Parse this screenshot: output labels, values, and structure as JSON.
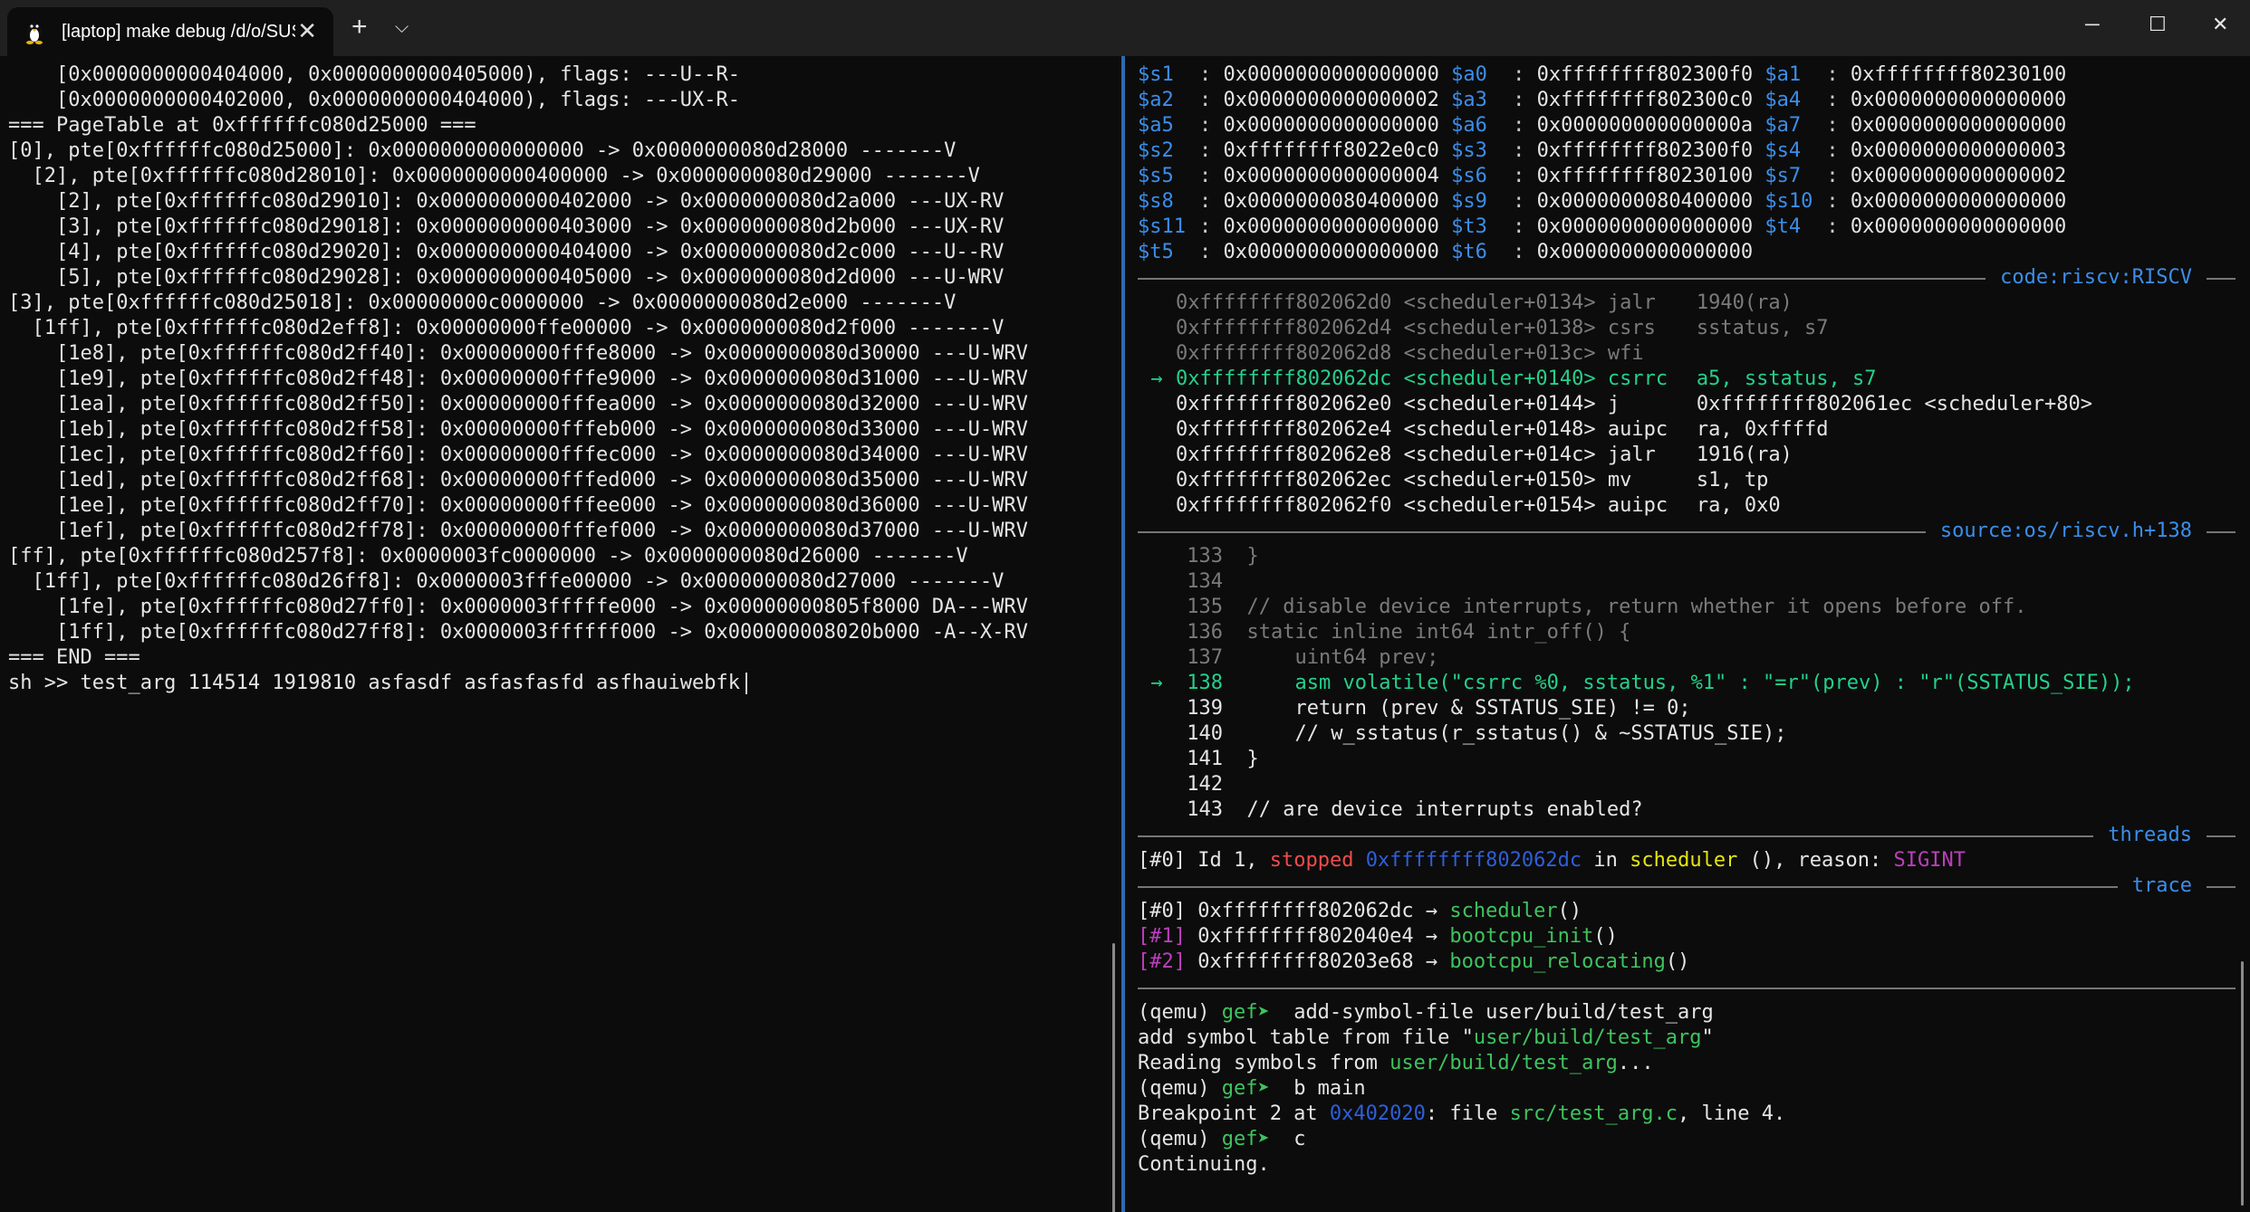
{
  "window": {
    "tab_title": "[laptop] make debug /d/o/SUS",
    "icons": [
      "linux-penguin-icon",
      "close-icon",
      "plus-icon",
      "chevron-down-icon",
      "minimize-icon",
      "maximize-icon",
      "window-close-icon"
    ]
  },
  "colors": {
    "background": "#0c0c0c",
    "register": "#3b8eea",
    "separator_title": "#3b8eea",
    "current_line": "#23d18b",
    "divider": "#2d6ab0"
  },
  "left": {
    "lines": [
      "    [0x0000000000404000, 0x0000000000405000), flags: ---U--R-",
      "    [0x0000000000402000, 0x0000000000404000), flags: ---UX-R-",
      "=== PageTable at 0xffffffc080d25000 ===",
      "[0], pte[0xffffffc080d25000]: 0x0000000000000000 -> 0x0000000080d28000 -------V",
      "  [2], pte[0xffffffc080d28010]: 0x0000000000400000 -> 0x0000000080d29000 -------V",
      "    [2], pte[0xffffffc080d29010]: 0x0000000000402000 -> 0x0000000080d2a000 ---UX-RV",
      "    [3], pte[0xffffffc080d29018]: 0x0000000000403000 -> 0x0000000080d2b000 ---UX-RV",
      "    [4], pte[0xffffffc080d29020]: 0x0000000000404000 -> 0x0000000080d2c000 ---U--RV",
      "    [5], pte[0xffffffc080d29028]: 0x0000000000405000 -> 0x0000000080d2d000 ---U-WRV",
      "[3], pte[0xffffffc080d25018]: 0x00000000c0000000 -> 0x0000000080d2e000 -------V",
      "  [1ff], pte[0xffffffc080d2eff8]: 0x00000000ffe00000 -> 0x0000000080d2f000 -------V",
      "    [1e8], pte[0xffffffc080d2ff40]: 0x00000000fffe8000 -> 0x0000000080d30000 ---U-WRV",
      "    [1e9], pte[0xffffffc080d2ff48]: 0x00000000fffe9000 -> 0x0000000080d31000 ---U-WRV",
      "    [1ea], pte[0xffffffc080d2ff50]: 0x00000000fffea000 -> 0x0000000080d32000 ---U-WRV",
      "    [1eb], pte[0xffffffc080d2ff58]: 0x00000000fffeb000 -> 0x0000000080d33000 ---U-WRV",
      "    [1ec], pte[0xffffffc080d2ff60]: 0x00000000fffec000 -> 0x0000000080d34000 ---U-WRV",
      "    [1ed], pte[0xffffffc080d2ff68]: 0x00000000fffed000 -> 0x0000000080d35000 ---U-WRV",
      "    [1ee], pte[0xffffffc080d2ff70]: 0x00000000fffee000 -> 0x0000000080d36000 ---U-WRV",
      "    [1ef], pte[0xffffffc080d2ff78]: 0x00000000fffef000 -> 0x0000000080d37000 ---U-WRV",
      "[ff], pte[0xffffffc080d257f8]: 0x0000003fc0000000 -> 0x0000000080d26000 -------V",
      "  [1ff], pte[0xffffffc080d26ff8]: 0x0000003fffe00000 -> 0x0000000080d27000 -------V",
      "    [1fe], pte[0xffffffc080d27ff0]: 0x0000003fffffe000 -> 0x00000000805f8000 DA---WRV",
      "    [1ff], pte[0xffffffc080d27ff8]: 0x0000003ffffff000 -> 0x000000008020b000 -A--X-RV",
      "=== END ==="
    ],
    "prompt": "sh >> test_arg 114514 1919810 asfasdf asfasfasfd asfhauiwebfk"
  },
  "registers": [
    [
      [
        "$s1",
        "0x0000000000000000"
      ],
      [
        "$a0",
        "0xffffffff802300f0"
      ],
      [
        "$a1",
        "0xffffffff80230100"
      ]
    ],
    [
      [
        "$a2",
        "0x0000000000000002"
      ],
      [
        "$a3",
        "0xffffffff802300c0"
      ],
      [
        "$a4",
        "0x0000000000000000"
      ]
    ],
    [
      [
        "$a5",
        "0x0000000000000000"
      ],
      [
        "$a6",
        "0x000000000000000a"
      ],
      [
        "$a7",
        "0x0000000000000000"
      ]
    ],
    [
      [
        "$s2",
        "0xffffffff8022e0c0"
      ],
      [
        "$s3",
        "0xffffffff802300f0"
      ],
      [
        "$s4",
        "0x0000000000000003"
      ]
    ],
    [
      [
        "$s5",
        "0x0000000000000004"
      ],
      [
        "$s6",
        "0xffffffff80230100"
      ],
      [
        "$s7",
        "0x0000000000000002"
      ]
    ],
    [
      [
        "$s8",
        "0x0000000080400000"
      ],
      [
        "$s9",
        "0x0000000080400000"
      ],
      [
        "$s10",
        "0x0000000000000000"
      ]
    ],
    [
      [
        "$s11",
        "0x0000000000000000"
      ],
      [
        "$t3",
        "0x0000000000000000"
      ],
      [
        "$t4",
        "0x0000000000000000"
      ]
    ],
    [
      [
        "$t5",
        "0x0000000000000000"
      ],
      [
        "$t6",
        "0x0000000000000000"
      ]
    ]
  ],
  "code": {
    "title": "code:riscv:RISCV",
    "arrow": "→",
    "lines": [
      {
        "addr": "0xffffffff802062d0",
        "sym": "<scheduler+0134>",
        "op": "jalr",
        "args": "1940(ra)",
        "state": "past"
      },
      {
        "addr": "0xffffffff802062d4",
        "sym": "<scheduler+0138>",
        "op": "csrs",
        "args": "sstatus, s7",
        "state": "past"
      },
      {
        "addr": "0xffffffff802062d8",
        "sym": "<scheduler+013c>",
        "op": "wfi",
        "args": "",
        "state": "past"
      },
      {
        "addr": "0xffffffff802062dc",
        "sym": "<scheduler+0140>",
        "op": "csrrc",
        "args": "a5, sstatus, s7",
        "state": "current"
      },
      {
        "addr": "0xffffffff802062e0",
        "sym": "<scheduler+0144>",
        "op": "j",
        "args": "0xffffffff802061ec <scheduler+80>",
        "state": "next"
      },
      {
        "addr": "0xffffffff802062e4",
        "sym": "<scheduler+0148>",
        "op": "auipc",
        "args": "ra, 0xffffd",
        "state": "next"
      },
      {
        "addr": "0xffffffff802062e8",
        "sym": "<scheduler+014c>",
        "op": "jalr",
        "args": "1916(ra)",
        "state": "next"
      },
      {
        "addr": "0xffffffff802062ec",
        "sym": "<scheduler+0150>",
        "op": "mv",
        "args": "s1, tp",
        "state": "next"
      },
      {
        "addr": "0xffffffff802062f0",
        "sym": "<scheduler+0154>",
        "op": "auipc",
        "args": "ra, 0x0",
        "state": "next"
      }
    ]
  },
  "source": {
    "title": "source:os/riscv.h+138",
    "lines": [
      {
        "num": "133",
        "text": "}",
        "state": "past"
      },
      {
        "num": "134",
        "text": "",
        "state": "past"
      },
      {
        "num": "135",
        "text": "// disable device interrupts, return whether it opens before off.",
        "state": "past"
      },
      {
        "num": "136",
        "text": "static inline int64 intr_off() {",
        "state": "past"
      },
      {
        "num": "137",
        "text": "    uint64 prev;",
        "state": "past"
      },
      {
        "num": "138",
        "text": "    asm volatile(\"csrrc %0, sstatus, %1\" : \"=r\"(prev) : \"r\"(SSTATUS_SIE));",
        "state": "current"
      },
      {
        "num": "139",
        "text": "    return (prev & SSTATUS_SIE) != 0;",
        "state": "next"
      },
      {
        "num": "140",
        "text": "    // w_sstatus(r_sstatus() & ~SSTATUS_SIE);",
        "state": "next"
      },
      {
        "num": "141",
        "text": "}",
        "state": "next"
      },
      {
        "num": "142",
        "text": "",
        "state": "next"
      },
      {
        "num": "143",
        "text": "// are device interrupts enabled?",
        "state": "next"
      }
    ]
  },
  "threads": {
    "title": "threads",
    "entry": {
      "idx": "[#0]",
      "id": "Id 1,",
      "status": "stopped",
      "addr": "0xffffffff802062dc",
      "in": "in",
      "func": "scheduler",
      "paren": " (), reason: ",
      "reason": "SIGINT"
    }
  },
  "trace": {
    "title": "trace",
    "frames": [
      {
        "idx": "[#0]",
        "addr": "0xffffffff802062dc",
        "arrow": "→",
        "func": "scheduler",
        "suffix": "()"
      },
      {
        "idx": "[#1]",
        "addr": "0xffffffff802040e4",
        "arrow": "→",
        "func": "bootcpu_init",
        "suffix": "()"
      },
      {
        "idx": "[#2]",
        "addr": "0xffffffff80203e68",
        "arrow": "→",
        "func": "bootcpu_relocating",
        "suffix": "()"
      }
    ]
  },
  "console": {
    "prompt_prefix": "(qemu) ",
    "prompt_gef": "gef➤",
    "cmd1": "  add-symbol-file user/build/test_arg",
    "out1_a": "add symbol table from file \"",
    "out1_b": "user/build/test_arg",
    "out1_c": "\"",
    "out2_a": "Reading symbols from ",
    "out2_b": "user/build/test_arg",
    "out2_c": "...",
    "cmd2": "  b main",
    "out3_a": "Breakpoint 2 at ",
    "out3_b": "0x402020",
    "out3_c": ": file ",
    "out3_d": "src/test_arg.c",
    "out3_e": ", line 4.",
    "cmd3": "  c",
    "out4": "Continuing."
  }
}
